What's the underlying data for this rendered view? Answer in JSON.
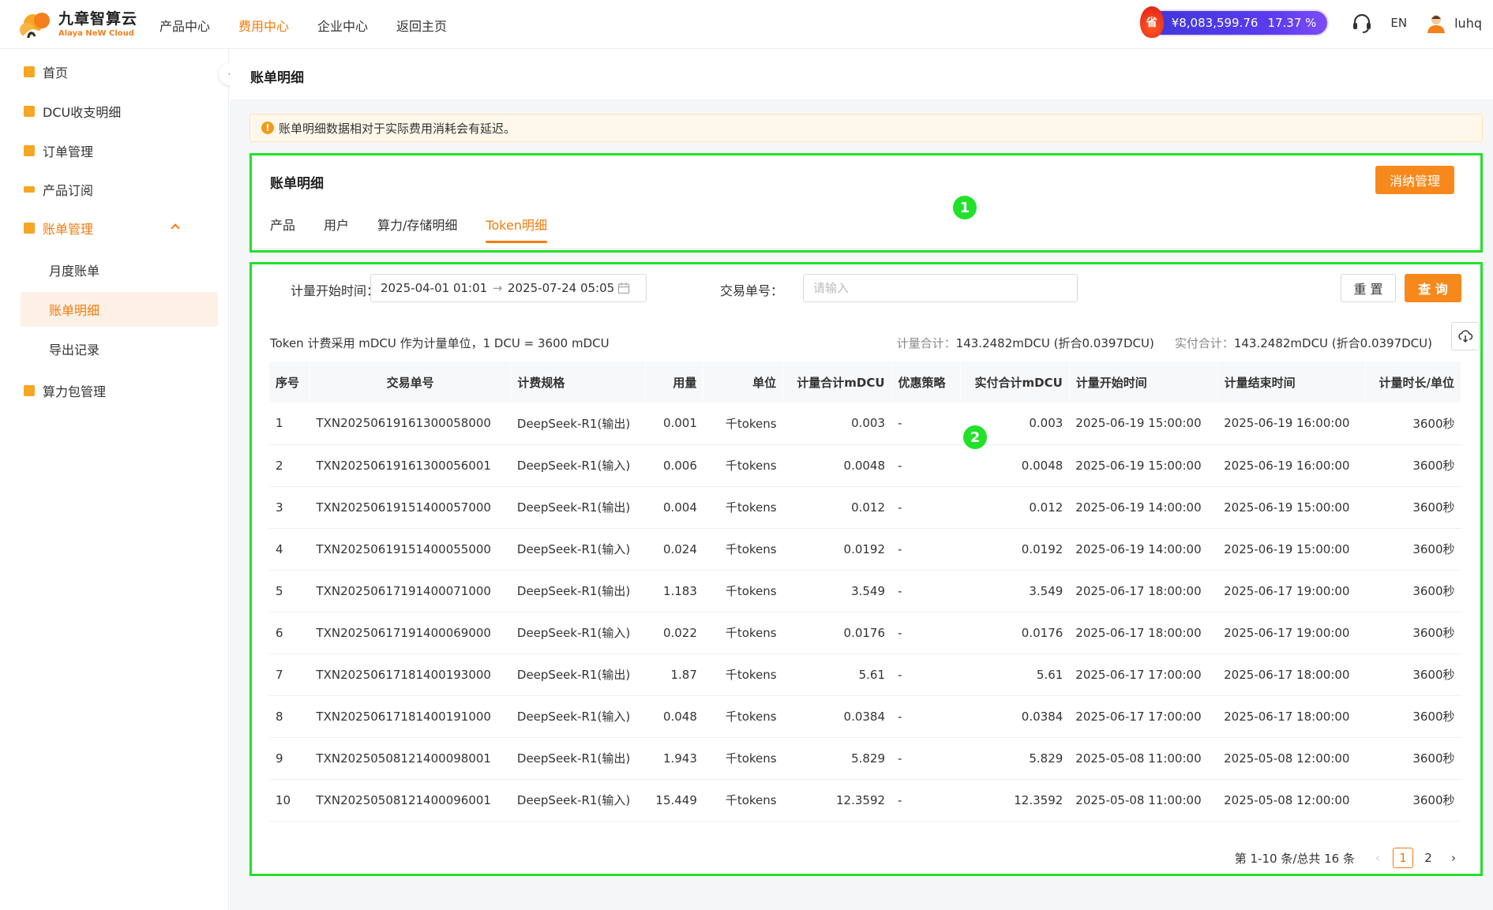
{
  "brand": {
    "name_cn": "九章智算云",
    "name_en": "Alaya NeW Cloud"
  },
  "nav": [
    {
      "label": "产品中心",
      "active": false
    },
    {
      "label": "费用中心",
      "active": true
    },
    {
      "label": "企业中心",
      "active": false
    },
    {
      "label": "返回主页",
      "active": false
    }
  ],
  "topbar": {
    "badge": "省",
    "balance": "¥8,083,599.76",
    "percent": "17.37 %",
    "lang": "EN",
    "user": "luhq",
    "icons": {
      "support": "headset-icon",
      "avatar": "avatar-icon"
    }
  },
  "sidebar": {
    "items": [
      {
        "label": "首页",
        "icon": "home-icon"
      },
      {
        "label": "DCU收支明细",
        "icon": "ledger-icon"
      },
      {
        "label": "订单管理",
        "icon": "order-icon"
      },
      {
        "label": "产品订阅",
        "icon": "subscribe-icon"
      },
      {
        "label": "账单管理",
        "icon": "bill-icon",
        "expanded": true
      },
      {
        "label": "算力包管理",
        "icon": "package-icon"
      }
    ],
    "sub": [
      {
        "label": "月度账单",
        "active": false
      },
      {
        "label": "账单明细",
        "active": true
      },
      {
        "label": "导出记录",
        "active": false
      }
    ]
  },
  "page": {
    "title": "账单明细",
    "notice": "账单明细数据相对于实际费用消耗会有延迟。"
  },
  "card": {
    "title": "账单明细",
    "action": "消纳管理",
    "tabs": [
      {
        "label": "产品",
        "active": false
      },
      {
        "label": "用户",
        "active": false
      },
      {
        "label": "算力/存储明细",
        "active": false
      },
      {
        "label": "Token明细",
        "active": true
      }
    ]
  },
  "filters": {
    "start_label": "计量开始时间：",
    "start": "2025-04-01 01:01:0",
    "end": "2025-07-24 05:05:0",
    "txn_label": "交易单号：",
    "txn_placeholder": "请输入",
    "reset": "重 置",
    "query": "查 询"
  },
  "summary": {
    "info": "Token 计费采用 mDCU 作为计量单位，1 DCU = 3600 mDCU",
    "metered_label": "计量合计：",
    "metered": "143.2482mDCU (折合0.0397DCU)",
    "paid_label": "实付合计：",
    "paid": "143.2482mDCU (折合0.0397DCU)"
  },
  "table": {
    "headers": [
      "序号",
      "交易单号",
      "计费规格",
      "用量",
      "单位",
      "计量合计mDCU",
      "优惠策略",
      "实付合计mDCU",
      "计量开始时间",
      "计量结束时间",
      "计量时长/单位"
    ],
    "rows": [
      [
        "1",
        "TXN20250619161300058000",
        "DeepSeek-R1(输出)",
        "0.001",
        "千tokens",
        "0.003",
        "-",
        "0.003",
        "2025-06-19 15:00:00",
        "2025-06-19 16:00:00",
        "3600秒"
      ],
      [
        "2",
        "TXN20250619161300056001",
        "DeepSeek-R1(输入)",
        "0.006",
        "千tokens",
        "0.0048",
        "-",
        "0.0048",
        "2025-06-19 15:00:00",
        "2025-06-19 16:00:00",
        "3600秒"
      ],
      [
        "3",
        "TXN20250619151400057000",
        "DeepSeek-R1(输出)",
        "0.004",
        "千tokens",
        "0.012",
        "-",
        "0.012",
        "2025-06-19 14:00:00",
        "2025-06-19 15:00:00",
        "3600秒"
      ],
      [
        "4",
        "TXN20250619151400055000",
        "DeepSeek-R1(输入)",
        "0.024",
        "千tokens",
        "0.0192",
        "-",
        "0.0192",
        "2025-06-19 14:00:00",
        "2025-06-19 15:00:00",
        "3600秒"
      ],
      [
        "5",
        "TXN20250617191400071000",
        "DeepSeek-R1(输出)",
        "1.183",
        "千tokens",
        "3.549",
        "-",
        "3.549",
        "2025-06-17 18:00:00",
        "2025-06-17 19:00:00",
        "3600秒"
      ],
      [
        "6",
        "TXN20250617191400069000",
        "DeepSeek-R1(输入)",
        "0.022",
        "千tokens",
        "0.0176",
        "-",
        "0.0176",
        "2025-06-17 18:00:00",
        "2025-06-17 19:00:00",
        "3600秒"
      ],
      [
        "7",
        "TXN20250617181400193000",
        "DeepSeek-R1(输出)",
        "1.87",
        "千tokens",
        "5.61",
        "-",
        "5.61",
        "2025-06-17 17:00:00",
        "2025-06-17 18:00:00",
        "3600秒"
      ],
      [
        "8",
        "TXN20250617181400191000",
        "DeepSeek-R1(输入)",
        "0.048",
        "千tokens",
        "0.0384",
        "-",
        "0.0384",
        "2025-06-17 17:00:00",
        "2025-06-17 18:00:00",
        "3600秒"
      ],
      [
        "9",
        "TXN20250508121400098001",
        "DeepSeek-R1(输出)",
        "1.943",
        "千tokens",
        "5.829",
        "-",
        "5.829",
        "2025-05-08 11:00:00",
        "2025-05-08 12:00:00",
        "3600秒"
      ],
      [
        "10",
        "TXN20250508121400096001",
        "DeepSeek-R1(输入)",
        "15.449",
        "千tokens",
        "12.3592",
        "-",
        "12.3592",
        "2025-05-08 11:00:00",
        "2025-05-08 12:00:00",
        "3600秒"
      ]
    ]
  },
  "pagination": {
    "summary": "第 1-10 条/总共 16 条",
    "pages": [
      "1",
      "2"
    ],
    "current": "1"
  },
  "annotations": [
    "1",
    "2"
  ],
  "colors": {
    "accent": "#f27b0d",
    "button": "#f7891c",
    "annotation": "#22e12b",
    "balance": "#4a3ae0"
  }
}
